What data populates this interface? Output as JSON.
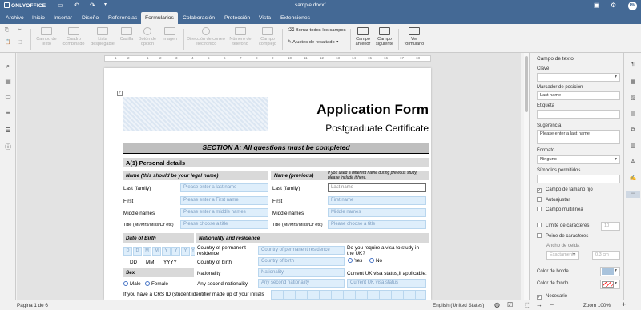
{
  "titlebar": {
    "app_name": "ONLYOFFICE",
    "doc_title": "sample.docxf",
    "avatar": "PM"
  },
  "tabs": [
    {
      "label": "Archivo"
    },
    {
      "label": "Inicio"
    },
    {
      "label": "Insertar"
    },
    {
      "label": "Diseño"
    },
    {
      "label": "Referencias"
    },
    {
      "label": "Formularios"
    },
    {
      "label": "Colaboración"
    },
    {
      "label": "Protección"
    },
    {
      "label": "Vista"
    },
    {
      "label": "Extensiones"
    }
  ],
  "ribbon": {
    "text_field": "Campo de texto",
    "combo_box": "Cuadro combinado",
    "dropdown": "Lista desplegable",
    "checkbox": "Casilla",
    "radio_button": "Botón de opción",
    "image": "Imagen",
    "email": "Dirección de correo electrónico",
    "phone": "Número de teléfono",
    "complex": "Campo complejo",
    "clear_all": "Borrar todos los campos",
    "highlight": "Ajustes de resaltado",
    "prev_field": "Campo anterior",
    "next_field": "Campo siguiente",
    "view_form": "Ver formulario"
  },
  "ruler": {
    "ticks": [
      "1",
      "2",
      "1",
      "2",
      "3",
      "4",
      "5",
      "6",
      "7",
      "8",
      "9",
      "10",
      "11",
      "12",
      "13",
      "14",
      "15",
      "16",
      "17",
      "18"
    ]
  },
  "document": {
    "title": "Application Form",
    "subtitle": "Postgraduate Certificate",
    "section_a": "SECTION A: All questions must be completed",
    "a1": "A(1) Personal details",
    "name_legal": "Name (this should be your legal name)",
    "name_previous": "Name (previous)",
    "name_previous_note": "If you used a different name during previous study, please include it here.",
    "rows_left": [
      {
        "label": "Last (family)",
        "placeholder": "Please enter a last name"
      },
      {
        "label": "First",
        "placeholder": "Please enter a First name"
      },
      {
        "label": "Middle names",
        "placeholder": "Please enter a middle names"
      },
      {
        "label": "Title (Mr/Mrs/Miss/Dr etc)",
        "placeholder": "Please choose a title"
      }
    ],
    "rows_right": [
      {
        "label": "Last (family)",
        "placeholder": "Last name"
      },
      {
        "label": "First",
        "placeholder": "First name"
      },
      {
        "label": "Middle names",
        "placeholder": "Middle names"
      },
      {
        "label": "Title (Mr/Mrs/Miss/Dr etc)",
        "placeholder": "Please choose a title"
      }
    ],
    "dob": "Date of Birth",
    "nationality_head": "Nationality and residence",
    "dob_boxes": [
      "D",
      "D",
      "M",
      "M",
      "Y",
      "Y",
      "Y",
      "Y"
    ],
    "dob_labels": [
      "DD",
      "MM",
      "YYYY"
    ],
    "country_residence": "Country of permanent residence",
    "country_residence_ph": "Country of permanent residence",
    "country_birth": "Country of birth",
    "country_birth_ph": "Country of birth",
    "nationality": "Nationality",
    "nationality_ph": "Nationality",
    "second_nationality": "Any second nationality",
    "second_nationality_ph": "Any second nationality",
    "visa_q": "Do you require a visa to study in the UK?",
    "yes": "Yes",
    "no": "No",
    "visa_status": "Current UK visa status,if applicable:",
    "visa_status_ph": "Current UK visa status",
    "sex": "Sex",
    "male": "Male",
    "female": "Female",
    "crs": "If you have a CRS ID (student identifier made up of your initials"
  },
  "right_panel": {
    "heading": "Campo de texto",
    "key_label": "Clave",
    "placeholder_label": "Marcador de posición",
    "placeholder_value": "Last name",
    "tag_label": "Etiqueta",
    "tip_label": "Sugerencia",
    "tip_value": "Please enter a last name",
    "format_label": "Formato",
    "format_value": "Ninguno",
    "allowed_label": "Símbolos permitidos",
    "fixed": "Campo de tamaño fijo",
    "autofit": "Autoajustar",
    "multiline": "Campo multilínea",
    "char_limit": "Límite de caracteres",
    "char_limit_value": "10",
    "comb": "Peine de caracteres",
    "cell_width": "Ancho de celda",
    "cell_width_mode": "Exactamente",
    "cell_width_value": "0.3 cm",
    "border_color": "Color de borde",
    "bg_color": "Color de fondo",
    "required": "Necesario",
    "border_swatch": "#a9c3dc"
  },
  "statusbar": {
    "page": "Página 1 de 6",
    "language": "English (United States)",
    "zoom": "Zoom 100%"
  }
}
